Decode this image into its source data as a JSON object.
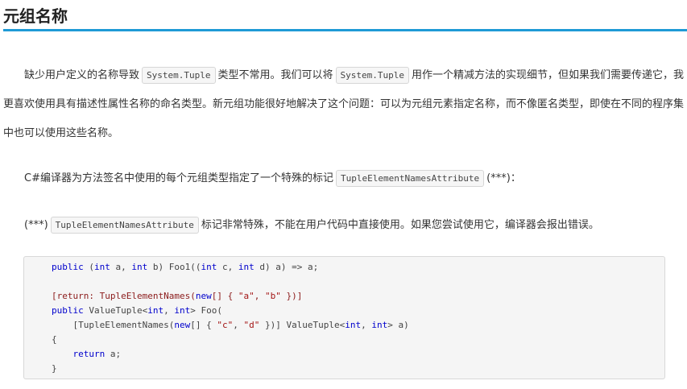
{
  "section": {
    "title": "元组名称"
  },
  "paragraphs": {
    "p1": {
      "t1": "缺少用户定义的名称导致",
      "c1": "System.Tuple",
      "t2": "类型不常用。我们可以将",
      "c2": "System.Tuple",
      "t3": "用作一个精减方法的实现细节，但如果我们需要传递它，我更喜欢使用具有描述性属性名称的命名类型。新元组功能很好地解决了这个问题：可以为元组元素指定名称，而不像匿名类型，即使在不同的程序集中也可以使用这些名称。"
    },
    "p2": {
      "t1": "C#编译器为方法签名中使用的每个元组类型指定了一个特殊的标记",
      "c1": "TupleElementNamesAttribute",
      "t2": "(***)："
    },
    "p3": {
      "t0": "(***)",
      "c1": "TupleElementNamesAttribute",
      "t1": "标记非常特殊，不能在用户代码中直接使用。如果您尝试使用它，编译器会报出错误。"
    }
  },
  "code": {
    "l1": {
      "k1": "public",
      "a": " (",
      "k2": "int",
      "b": " a, ",
      "k3": "int",
      "c": " b) Foo1((",
      "k4": "int",
      "d": " c, ",
      "k5": "int",
      "e": " d) a) => a;"
    },
    "l2": {
      "a": "[",
      "k1": "return:",
      "b": " TupleElementNames(",
      "k2": "new",
      "c": "[] { ",
      "s1": "\"a\"",
      "d": ", ",
      "s2": "\"b\"",
      "e": " })]"
    },
    "l3": {
      "k1": "public",
      "a": " ValueTuple<",
      "k2": "int",
      "b": ", ",
      "k3": "int",
      "c": "> Foo("
    },
    "l4": {
      "a": "    [TupleElementNames(",
      "k1": "new",
      "b": "[] { ",
      "s1": "\"c\"",
      "c": ", ",
      "s2": "\"d\"",
      "d": " })] ValueTuple<",
      "k2": "int",
      "e": ", ",
      "k3": "int",
      "f": "> a)"
    },
    "l5": {
      "a": "{"
    },
    "l6": {
      "a": "    ",
      "k1": "return",
      "b": " a;"
    },
    "l7": {
      "a": "}"
    }
  },
  "colors": {
    "accent_rule": "#1f9ad6",
    "keyword": "#0000cc",
    "string": "#a31515",
    "code_background": "#f5f5f5"
  }
}
